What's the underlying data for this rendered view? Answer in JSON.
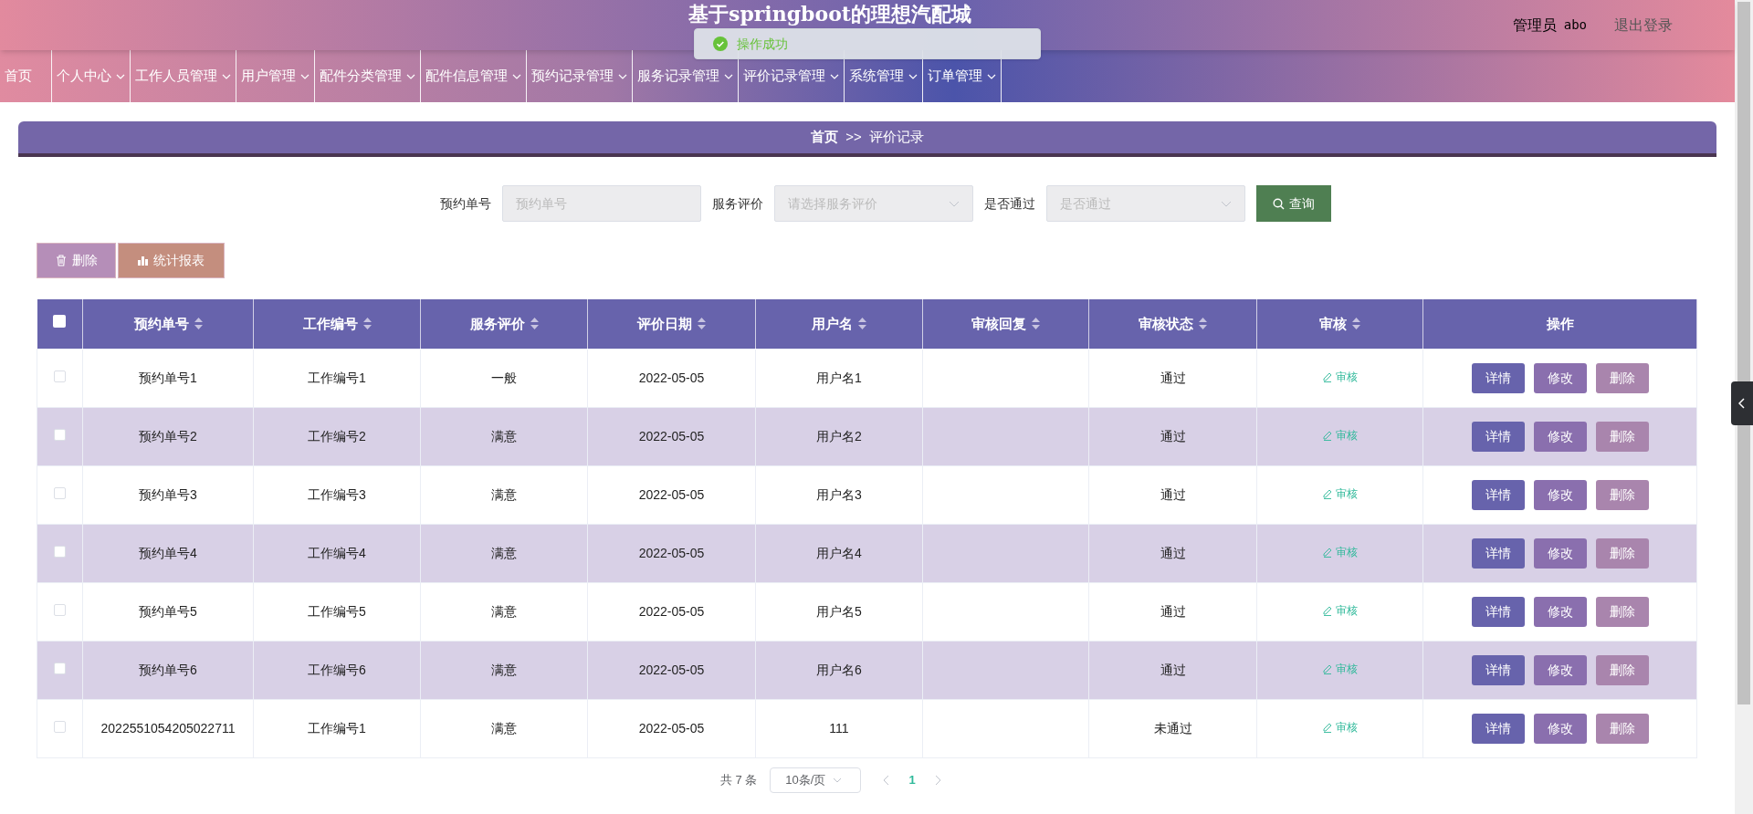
{
  "header": {
    "title": "基于springboot的理想汽配城",
    "user_role": "管理员",
    "username": "abo",
    "logout": "退出登录"
  },
  "toast": {
    "message": "操作成功"
  },
  "nav": [
    {
      "label": "首页",
      "dropdown": false
    },
    {
      "label": "个人中心",
      "dropdown": true
    },
    {
      "label": "工作人员管理",
      "dropdown": true
    },
    {
      "label": "用户管理",
      "dropdown": true
    },
    {
      "label": "配件分类管理",
      "dropdown": true
    },
    {
      "label": "配件信息管理",
      "dropdown": true
    },
    {
      "label": "预约记录管理",
      "dropdown": true
    },
    {
      "label": "服务记录管理",
      "dropdown": true
    },
    {
      "label": "评价记录管理",
      "dropdown": true
    },
    {
      "label": "系统管理",
      "dropdown": true
    },
    {
      "label": "订单管理",
      "dropdown": true
    }
  ],
  "breadcrumb": {
    "home": "首页",
    "separator": ">>",
    "current": "评价记录"
  },
  "search": [
    {
      "kind": "input",
      "label": "预约单号",
      "placeholder": "预约单号"
    },
    {
      "kind": "select",
      "label": "服务评价",
      "placeholder": "请选择服务评价"
    },
    {
      "kind": "select",
      "label": "是否通过",
      "placeholder": "是否通过"
    }
  ],
  "search_button": "查询",
  "actions": [
    {
      "kind": "delete",
      "label": "删除"
    },
    {
      "kind": "report",
      "label": "统计报表"
    }
  ],
  "table": {
    "select_all": false,
    "columns": [
      {
        "label": "预约单号",
        "sortable": true
      },
      {
        "label": "工作编号",
        "sortable": true
      },
      {
        "label": "服务评价",
        "sortable": true
      },
      {
        "label": "评价日期",
        "sortable": true
      },
      {
        "label": "用户名",
        "sortable": true
      },
      {
        "label": "审核回复",
        "sortable": true
      },
      {
        "label": "审核状态",
        "sortable": true
      },
      {
        "label": "审核",
        "sortable": true
      },
      {
        "label": "操作",
        "sortable": false
      }
    ],
    "rows": [
      {
        "checked": false,
        "cells": [
          "预约单号1",
          "工作编号1",
          "一般",
          "2022-05-05",
          "用户名1",
          "",
          "通过"
        ],
        "review_link": "审核",
        "buttons": [
          "详情",
          "修改",
          "删除"
        ]
      },
      {
        "checked": false,
        "cells": [
          "预约单号2",
          "工作编号2",
          "满意",
          "2022-05-05",
          "用户名2",
          "",
          "通过"
        ],
        "review_link": "审核",
        "buttons": [
          "详情",
          "修改",
          "删除"
        ]
      },
      {
        "checked": false,
        "cells": [
          "预约单号3",
          "工作编号3",
          "满意",
          "2022-05-05",
          "用户名3",
          "",
          "通过"
        ],
        "review_link": "审核",
        "buttons": [
          "详情",
          "修改",
          "删除"
        ]
      },
      {
        "checked": false,
        "cells": [
          "预约单号4",
          "工作编号4",
          "满意",
          "2022-05-05",
          "用户名4",
          "",
          "通过"
        ],
        "review_link": "审核",
        "buttons": [
          "详情",
          "修改",
          "删除"
        ]
      },
      {
        "checked": false,
        "cells": [
          "预约单号5",
          "工作编号5",
          "满意",
          "2022-05-05",
          "用户名5",
          "",
          "通过"
        ],
        "review_link": "审核",
        "buttons": [
          "详情",
          "修改",
          "删除"
        ]
      },
      {
        "checked": false,
        "cells": [
          "预约单号6",
          "工作编号6",
          "满意",
          "2022-05-05",
          "用户名6",
          "",
          "通过"
        ],
        "review_link": "审核",
        "buttons": [
          "详情",
          "修改",
          "删除"
        ]
      },
      {
        "checked": false,
        "cells": [
          "2022551054205022711",
          "工作编号1",
          "满意",
          "2022-05-05",
          "111",
          "",
          "未通过"
        ],
        "review_link": "审核",
        "buttons": [
          "详情",
          "修改",
          "删除"
        ]
      }
    ]
  },
  "pagination": {
    "total": "共 7 条",
    "page_size": "10条/页",
    "pages": [
      {
        "label": "1",
        "selected": true
      }
    ]
  }
}
